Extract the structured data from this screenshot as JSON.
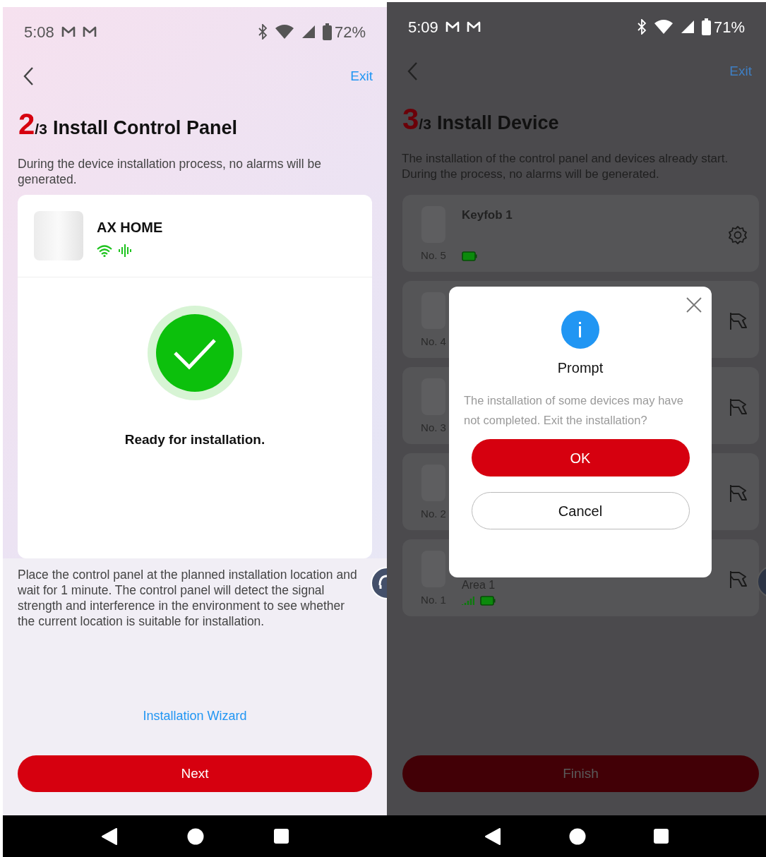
{
  "left_screen": {
    "status_bar": {
      "time": "5:08",
      "battery": "72%"
    },
    "exit_link": "Exit",
    "step": {
      "current": "2",
      "total": "/3"
    },
    "title": "Install Control Panel",
    "description": "During the device installation process, no alarms will be generated.",
    "device": {
      "name": "AX HOME"
    },
    "status": "Ready for installation.",
    "instructions": "Place the control panel at the planned installation location and wait for 1 minute. The control panel will detect the signal strength and interference in the environment to see whether the current location is suitable for installation.",
    "wizard_link": "Installation Wizard",
    "next_button": "Next"
  },
  "right_screen": {
    "status_bar": {
      "time": "5:09",
      "battery": "71%"
    },
    "exit_link": "Exit",
    "step": {
      "current": "3",
      "total": "/3"
    },
    "title": "Install Device",
    "description": "The installation of the control panel and devices already start. During the process, no alarms will be generated.",
    "devices": [
      {
        "number": "No. 5",
        "name": "Keyfob 1",
        "kind": "settings",
        "battery": true
      },
      {
        "number": "No. 4",
        "kind": "install"
      },
      {
        "number": "No. 3",
        "kind": "install"
      },
      {
        "number": "No. 2",
        "kind": "install"
      },
      {
        "number": "No. 1",
        "area": "Area 1",
        "kind": "install",
        "battery": true,
        "signal": true
      }
    ],
    "finish_button": "Finish",
    "dialog": {
      "title": "Prompt",
      "message": "The installation of some devices may have not completed. Exit the installation?",
      "buttons": [
        {
          "label": "OK",
          "kind": "primary"
        },
        {
          "label": "Cancel",
          "kind": "secondary"
        }
      ]
    }
  }
}
